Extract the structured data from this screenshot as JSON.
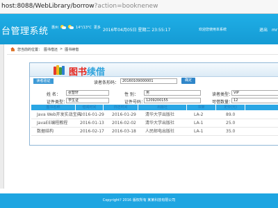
{
  "browser": {
    "url_host": "host:8088/WebLibrary/borrow",
    "url_path": "?action=booknenew"
  },
  "header": {
    "title": "台管理系统",
    "weather_city": "惠州",
    "weather_temp": "14°/13°C",
    "weather_more": "更多",
    "datetime": "2016年04月05日 星期二  23:55:17",
    "welcome": "欢迎您使用本系统",
    "user_links": [
      "退出",
      "mr"
    ]
  },
  "breadcrumb": {
    "prefix": "您当前的位置：",
    "items": [
      "图书借还",
      ">",
      "图书续借"
    ]
  },
  "panel": {
    "title_red": "图书",
    "title_blue": "续借",
    "reader_tag": "读者验证",
    "barcode_label": "读者条形码：",
    "barcode_value": "20160109000001",
    "confirm_label": "确定",
    "name_label": "姓    名：",
    "name_value": "张智轩",
    "gender_label": "性    别：",
    "gender_value": "男",
    "reader_type_label": "读者类型：",
    "reader_type_value": "VIP",
    "id_type_label": "证件类型：",
    "id_type_value": "学生证",
    "id_no_label": "证件号码：",
    "id_no_value": "1209200155",
    "max_label": "可借数量：",
    "max_value": "12"
  },
  "table": {
    "columns": [
      "图书名称",
      "借阅时间",
      "归还时间",
      "出版社",
      "书架",
      "定价(元)"
    ],
    "rows": [
      [
        "Java Web开发实战宝典",
        "2016-01-29",
        "2016-01-29",
        "清华大学出版社",
        "LA-2",
        "89.0"
      ],
      [
        "JavaEE编程教程",
        "2016-01-13",
        "2016-02-02",
        "清华大学出版社",
        "LA-1",
        "25.0"
      ],
      [
        "数据结构",
        "2016-02-17",
        "2016-03-18",
        "人民邮电出版社",
        "LA-1",
        "35.0"
      ]
    ]
  },
  "footer": {
    "copyright": "Copyright? 2016 版权所有 某某科技有限公司"
  },
  "colors": {
    "header_blue": "#1faee6",
    "footer_blue": "#1ea5e1",
    "title_red": "#e5241c",
    "title_blue": "#2fa3dc"
  }
}
